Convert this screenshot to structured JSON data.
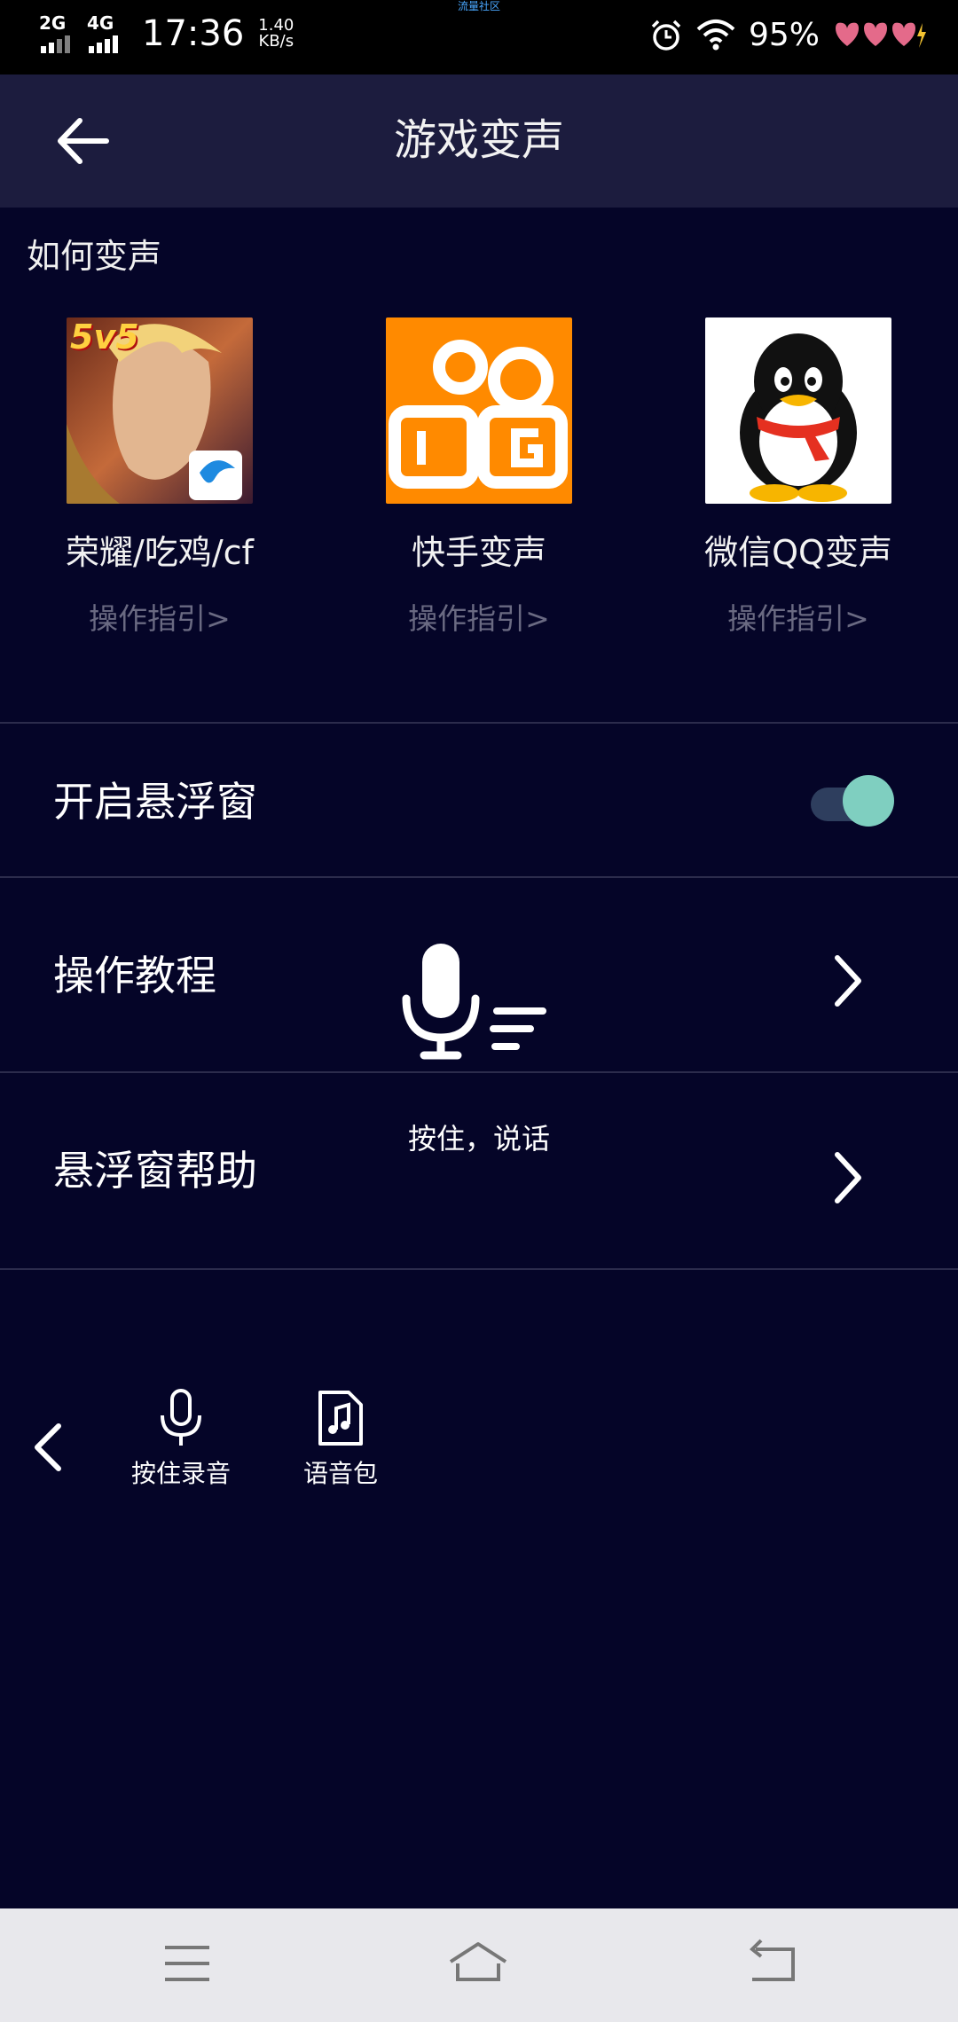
{
  "status_bar": {
    "network1": "2G",
    "network2": "4G",
    "time": "17:36",
    "speed_value": "1.40",
    "speed_unit": "KB/s",
    "battery": "95%",
    "carrier_text": "流量社区"
  },
  "header": {
    "title": "游戏变声"
  },
  "how_section": {
    "label": "如何变声",
    "apps": [
      {
        "name": "荣耀/吃鸡/cf",
        "guide": "操作指引>",
        "badge": "5v5"
      },
      {
        "name": "快手变声",
        "guide": "操作指引>"
      },
      {
        "name": "微信QQ变声",
        "guide": "操作指引>"
      }
    ]
  },
  "settings": {
    "float_window": {
      "label": "开启悬浮窗",
      "enabled": true
    },
    "tutorial": {
      "label": "操作教程"
    },
    "float_help": {
      "label": "悬浮窗帮助"
    }
  },
  "voice_overlay": {
    "hold_to_speak": "按住，说话"
  },
  "float_toolbar": {
    "record_label": "按住录音",
    "voice_pack_label": "语音包"
  },
  "colors": {
    "background": "#050528",
    "header": "#1c1c3e",
    "toggle_knob": "#7fcfc0",
    "guide_text": "#6a6a82"
  }
}
